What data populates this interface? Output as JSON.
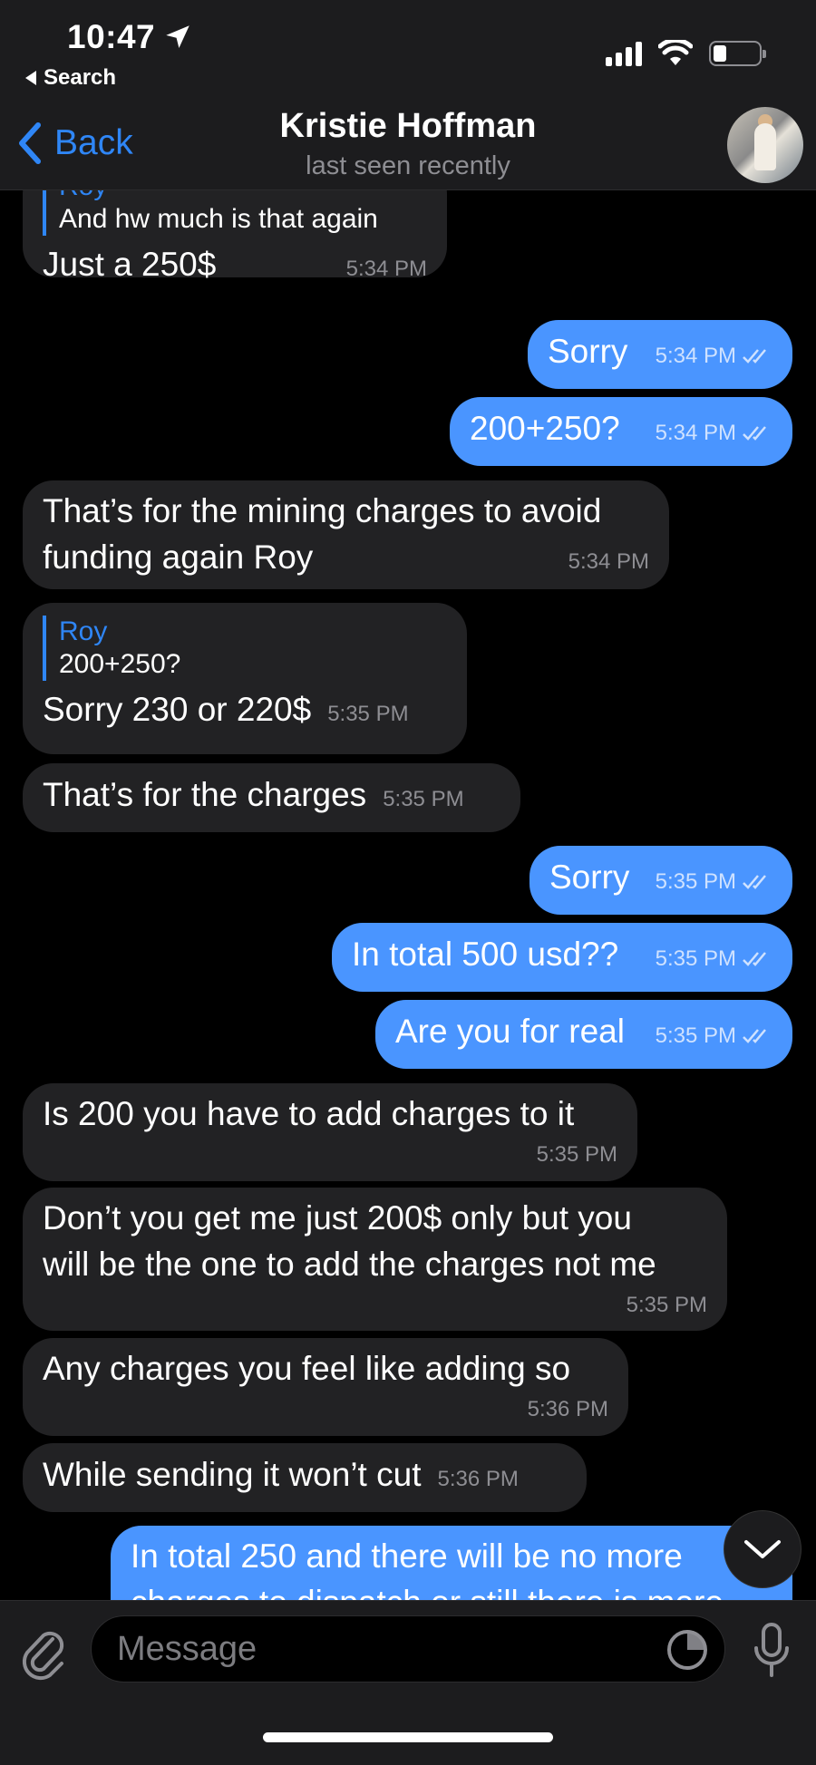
{
  "status_bar": {
    "time": "10:47",
    "back_app": "Search"
  },
  "header": {
    "back_label": "Back",
    "contact_name": "Kristie Hoffman",
    "last_seen": "last seen recently"
  },
  "messages": [
    {
      "dir": "in",
      "reply_name": "Roy",
      "reply_text": "And hw much is that again",
      "text": "Just a 250$",
      "time": "5:34 PM"
    },
    {
      "dir": "out",
      "text": "Sorry",
      "time": "5:34 PM"
    },
    {
      "dir": "out",
      "text": "200+250?",
      "time": "5:34 PM"
    },
    {
      "dir": "in",
      "line1": "That’s for the mining charges to avoid",
      "line2": "funding again Roy",
      "time": "5:34 PM"
    },
    {
      "dir": "in",
      "reply_name": "Roy",
      "reply_text": "200+250?",
      "text": "Sorry 230 or 220$",
      "time": "5:35 PM"
    },
    {
      "dir": "in",
      "text": "That’s for the charges",
      "time": "5:35 PM"
    },
    {
      "dir": "out",
      "text": "Sorry",
      "time": "5:35 PM"
    },
    {
      "dir": "out",
      "text": "In total 500 usd??",
      "time": "5:35 PM"
    },
    {
      "dir": "out",
      "text": "Are you for real",
      "time": "5:35 PM"
    },
    {
      "dir": "in",
      "text": "Is 200 you have to add charges to it",
      "time": "5:35 PM"
    },
    {
      "dir": "in",
      "line1": "Don’t you get me just 200$ only but you",
      "line2": "will be the one to add the charges not me",
      "time": "5:35 PM"
    },
    {
      "dir": "in",
      "text": "Any charges you feel like adding so",
      "time": "5:36 PM"
    },
    {
      "dir": "in",
      "text": "While sending it won’t cut",
      "time": "5:36 PM"
    },
    {
      "dir": "out",
      "line1": "In total 250 and there will be no more",
      "line2": "charges to dispatch or still there is more"
    }
  ],
  "input": {
    "placeholder": "Message"
  },
  "icons": {
    "back": "chevron-left-icon",
    "attach": "paperclip-icon",
    "sticker": "sticker-icon",
    "mic": "microphone-icon",
    "scroll": "chevron-down-icon",
    "read": "double-check-icon"
  },
  "colors": {
    "accent": "#2f86f6",
    "outgoing": "#4a95ff",
    "incoming": "#222224",
    "background": "#000000"
  }
}
